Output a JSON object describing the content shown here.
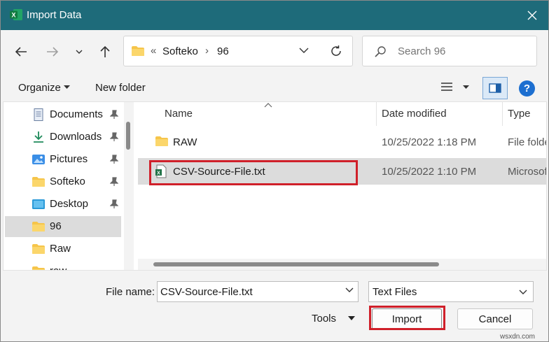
{
  "window": {
    "title": "Import Data"
  },
  "nav": {
    "path": [
      "Softeko",
      "96"
    ],
    "path_prefix": "«",
    "search_placeholder": "Search 96"
  },
  "toolbar": {
    "organize_label": "Organize",
    "new_folder_label": "New folder"
  },
  "sidebar": {
    "items": [
      {
        "label": "Documents",
        "icon": "document-icon",
        "pinned": true
      },
      {
        "label": "Downloads",
        "icon": "download-icon",
        "pinned": true
      },
      {
        "label": "Pictures",
        "icon": "pictures-icon",
        "pinned": true
      },
      {
        "label": "Softeko",
        "icon": "folder-icon",
        "pinned": true
      },
      {
        "label": "Desktop",
        "icon": "desktop-icon",
        "pinned": true
      },
      {
        "label": "96",
        "icon": "folder-icon",
        "pinned": false,
        "selected": true
      },
      {
        "label": "Raw",
        "icon": "folder-icon",
        "pinned": false
      },
      {
        "label": "raw",
        "icon": "folder-icon",
        "pinned": false
      }
    ]
  },
  "columns": {
    "name": "Name",
    "date": "Date modified",
    "type": "Type"
  },
  "files": [
    {
      "name": "RAW",
      "date": "10/25/2022 1:18 PM",
      "type": "File folder",
      "icon": "folder-icon"
    },
    {
      "name": "CSV-Source-File.txt",
      "date": "10/25/2022 1:10 PM",
      "type": "Microsoft Excel",
      "icon": "excel-file-icon",
      "selected": true
    }
  ],
  "footer": {
    "file_name_label": "File name:",
    "file_name_value": "CSV-Source-File.txt",
    "file_type_value": "Text Files",
    "tools_label": "Tools",
    "import_label": "Import",
    "cancel_label": "Cancel"
  },
  "watermark": "wsxdn.com",
  "colors": {
    "titlebar": "#1e6b7a",
    "highlight_box": "#d0202a",
    "selection": "#dcdcdc",
    "folder": "#f6c54a",
    "excel_green": "#1e7145"
  }
}
